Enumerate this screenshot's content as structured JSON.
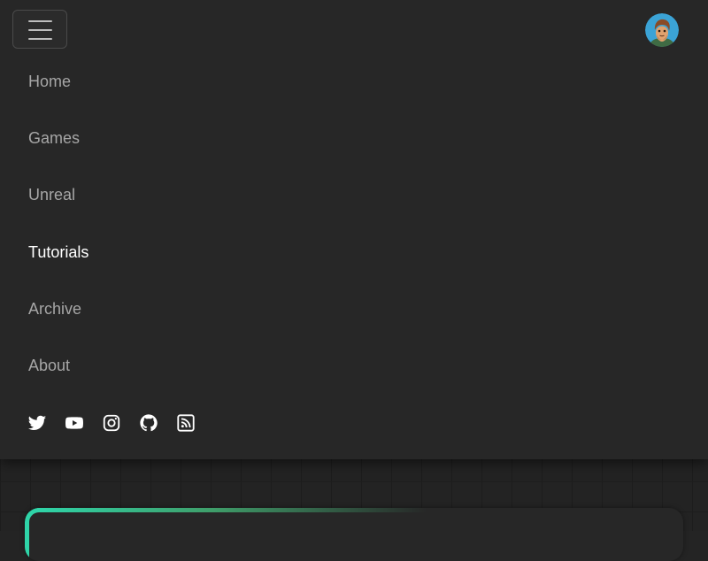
{
  "nav": {
    "items": [
      {
        "label": "Home",
        "active": false
      },
      {
        "label": "Games",
        "active": false
      },
      {
        "label": "Unreal",
        "active": false
      },
      {
        "label": "Tutorials",
        "active": true
      },
      {
        "label": "Archive",
        "active": false
      },
      {
        "label": "About",
        "active": false
      }
    ]
  },
  "socials": [
    {
      "icon": "twitter-icon"
    },
    {
      "icon": "youtube-icon"
    },
    {
      "icon": "instagram-icon"
    },
    {
      "icon": "github-icon"
    },
    {
      "icon": "rss-icon"
    }
  ],
  "header": {
    "menu_icon": "hamburger-menu-icon",
    "avatar_icon": "avatar"
  },
  "colors": {
    "panel_background": "#272727",
    "page_background": "#232323",
    "nav_text": "#a6a6a6",
    "nav_text_active": "#ffffff",
    "accent": "#2fd4a8"
  }
}
